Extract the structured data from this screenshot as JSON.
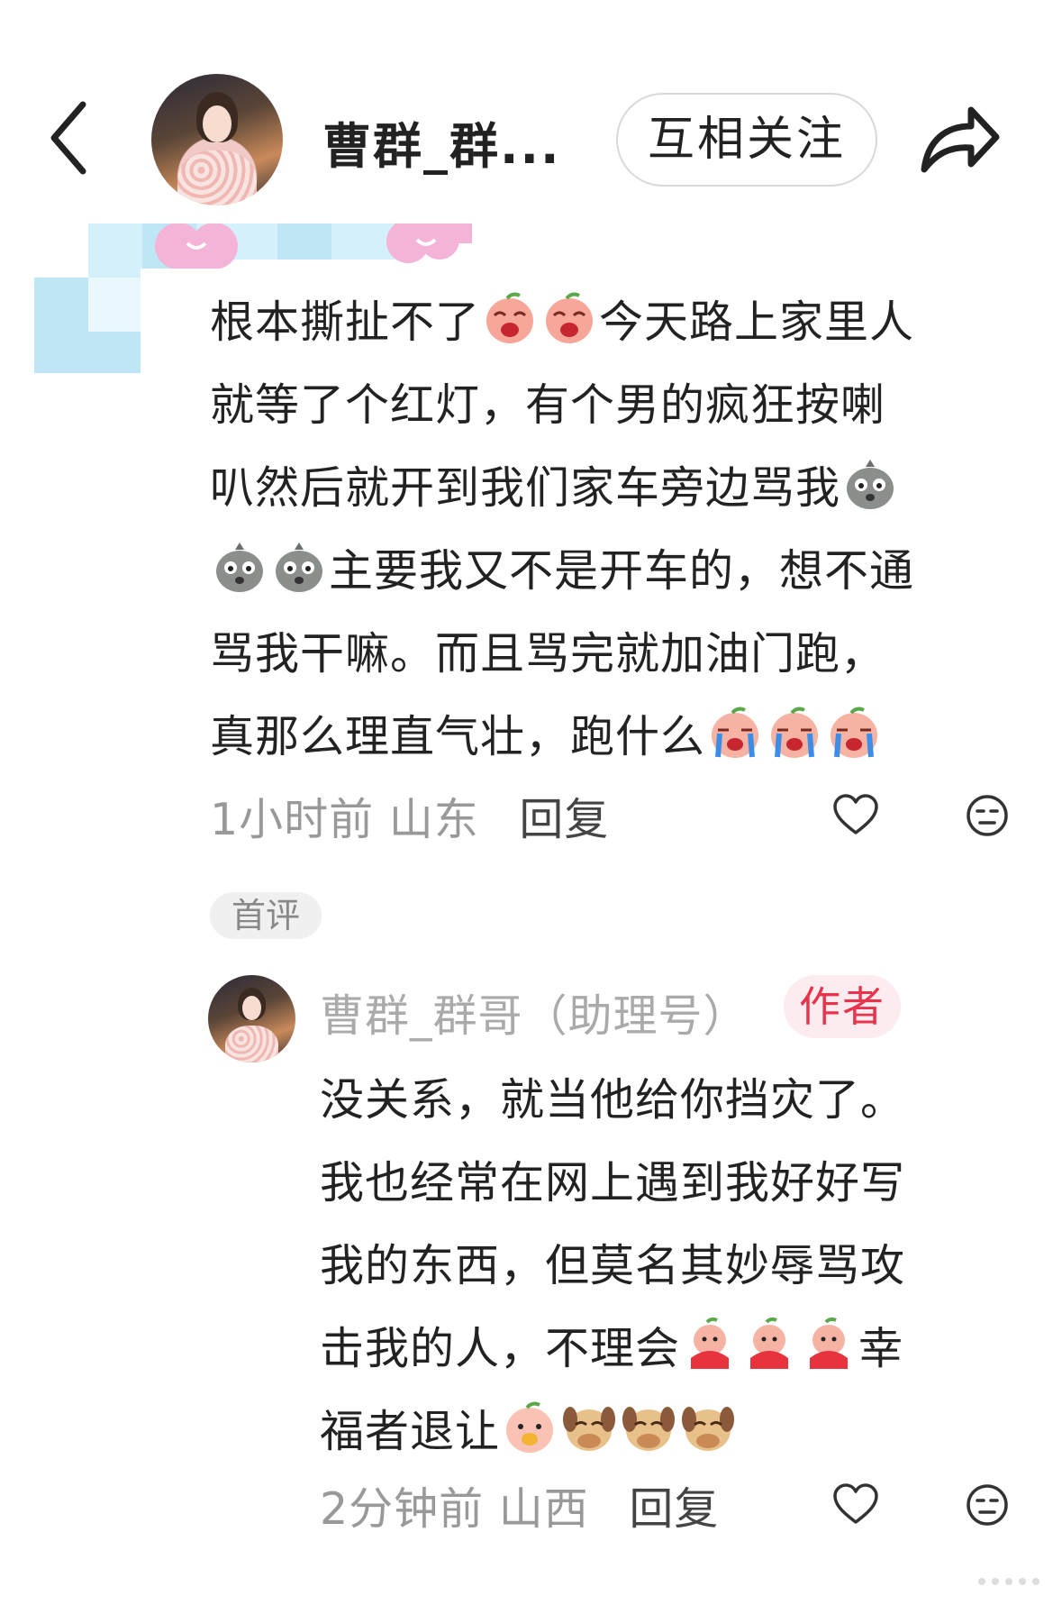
{
  "header": {
    "title": "曹群_群...",
    "follow_label": "互相关注"
  },
  "comment": {
    "lines": [
      [
        {
          "t": "text",
          "v": "根本撕扯不了"
        },
        {
          "t": "emoji",
          "name": "peach-cry-emoji"
        },
        {
          "t": "emoji",
          "name": "peach-cry-emoji"
        },
        {
          "t": "text",
          "v": "今天路上家里人"
        }
      ],
      [
        {
          "t": "text",
          "v": "就等了个红灯，有个男的疯狂按喇"
        }
      ],
      [
        {
          "t": "text",
          "v": "叭然后就开到我们家车旁边骂我"
        },
        {
          "t": "emoji",
          "name": "gray-bag-emoji"
        }
      ],
      [
        {
          "t": "emoji",
          "name": "gray-bag-emoji"
        },
        {
          "t": "emoji",
          "name": "gray-bag-emoji"
        },
        {
          "t": "text",
          "v": "主要我又不是开车的，想不通"
        }
      ],
      [
        {
          "t": "text",
          "v": "骂我干嘛。而且骂完就加油门跑，"
        }
      ],
      [
        {
          "t": "text",
          "v": "真那么理直气壮，跑什么"
        },
        {
          "t": "emoji",
          "name": "peach-tears-emoji"
        },
        {
          "t": "emoji",
          "name": "peach-tears-emoji"
        },
        {
          "t": "emoji",
          "name": "peach-tears-emoji"
        }
      ]
    ],
    "time": "1小时前",
    "location": "山东",
    "reply_label": "回复"
  },
  "first_badge": "首评",
  "reply": {
    "name": "曹群_群哥（助理号）",
    "author_badge": "作者",
    "lines": [
      [
        {
          "t": "text",
          "v": "没关系，就当他给你挡灾了。"
        }
      ],
      [
        {
          "t": "text",
          "v": "我也经常在网上遇到我好好写"
        }
      ],
      [
        {
          "t": "text",
          "v": "我的东西，但莫名其妙辱骂攻"
        }
      ],
      [
        {
          "t": "text",
          "v": "击我的人，不理会"
        },
        {
          "t": "emoji",
          "name": "peach-red-emoji"
        },
        {
          "t": "emoji",
          "name": "peach-red-emoji"
        },
        {
          "t": "emoji",
          "name": "peach-red-emoji"
        },
        {
          "t": "text",
          "v": "幸"
        }
      ],
      [
        {
          "t": "text",
          "v": "福者退让"
        },
        {
          "t": "emoji",
          "name": "peach-eat-emoji"
        },
        {
          "t": "emoji",
          "name": "dog-cover-emoji"
        },
        {
          "t": "emoji",
          "name": "dog-cover-emoji"
        },
        {
          "t": "emoji",
          "name": "dog-cover-emoji"
        }
      ]
    ],
    "time": "2分钟前",
    "location": "山西",
    "reply_label": "回复"
  }
}
